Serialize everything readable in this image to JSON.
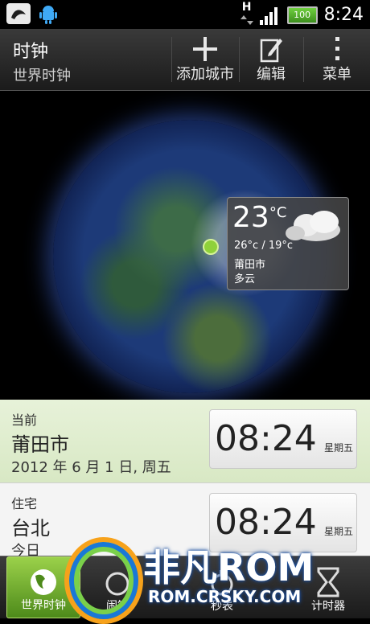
{
  "status_bar": {
    "network": "H",
    "battery": "100",
    "time": "8:24"
  },
  "header": {
    "title": "时钟",
    "subtitle": "世界时钟",
    "add_city": "添加城市",
    "edit": "编辑",
    "menu": "菜单"
  },
  "weather": {
    "temp": "23",
    "unit": "°C",
    "range": "26°c / 19°c",
    "city": "莆田市",
    "condition": "多云"
  },
  "current": {
    "label": "当前",
    "city": "莆田市",
    "date": "2012 年 6 月 1 日, 周五",
    "time": "08:24",
    "weekday": "星期五"
  },
  "home": {
    "label": "住宅",
    "city": "台北",
    "date": "今日",
    "time": "08:24",
    "weekday": "星期五"
  },
  "tabs": [
    {
      "label": "世界时钟"
    },
    {
      "label": "闹钟"
    },
    {
      "label": "秒表"
    },
    {
      "label": "计时器"
    }
  ],
  "watermark": {
    "brand": "非凡ROM",
    "url": "ROM.CRSKY.COM"
  },
  "colors": {
    "accent_green": "#8fd13a",
    "active_tab": "#6aa82b"
  }
}
